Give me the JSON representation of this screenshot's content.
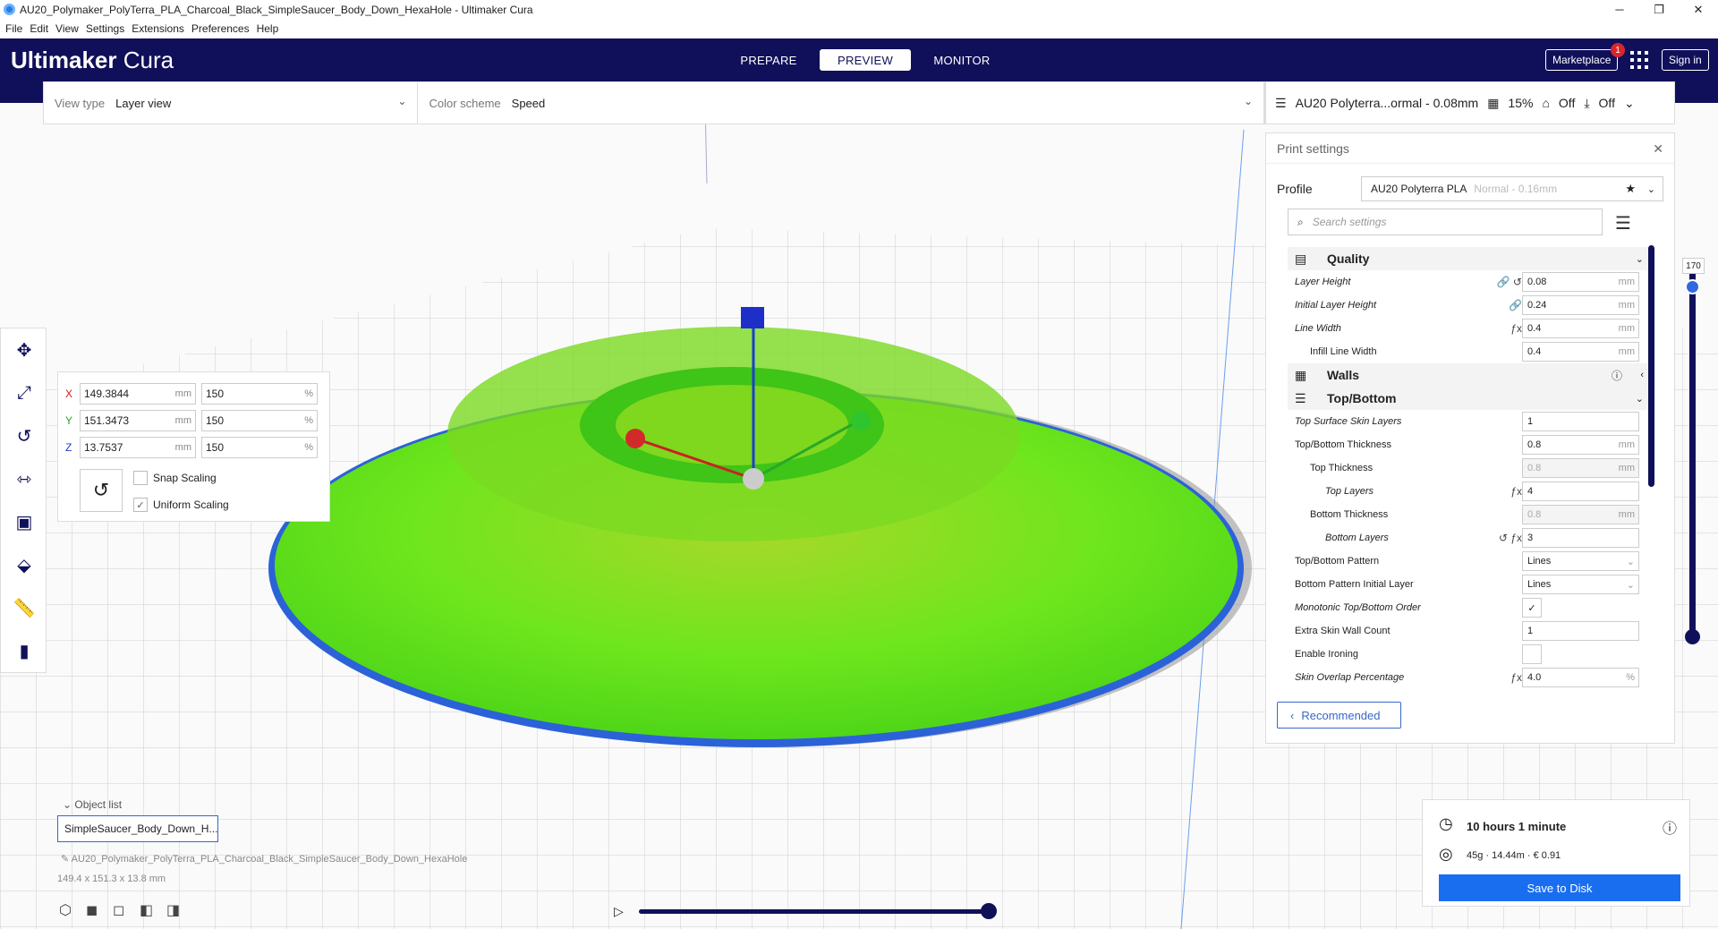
{
  "window": {
    "title": "AU20_Polymaker_PolyTerra_PLA_Charcoal_Black_SimpleSaucer_Body_Down_HexaHole - Ultimaker Cura"
  },
  "menu": [
    "File",
    "Edit",
    "View",
    "Settings",
    "Extensions",
    "Preferences",
    "Help"
  ],
  "header": {
    "logo_bold": "Ultimaker",
    "logo_thin": "Cura",
    "stages": [
      "PREPARE",
      "PREVIEW",
      "MONITOR"
    ],
    "active_stage": "PREVIEW",
    "marketplace": "Marketplace",
    "marketplace_badge": "1",
    "signin": "Sign in"
  },
  "viewbar": {
    "view_type_label": "View type",
    "view_type_value": "Layer view",
    "color_scheme_label": "Color scheme",
    "color_scheme_value": "Speed"
  },
  "printbar": {
    "profile": "AU20 Polyterra...ormal - 0.08mm",
    "infill": "15%",
    "support": "Off",
    "adhesion": "Off"
  },
  "scale": {
    "x_mm": "149.3844",
    "y_mm": "151.3473",
    "z_mm": "13.7537",
    "x_pct": "150",
    "y_pct": "150",
    "z_pct": "150",
    "unit_mm": "mm",
    "unit_pct": "%",
    "snap": "Snap Scaling",
    "uniform": "Uniform Scaling"
  },
  "settings": {
    "title": "Print settings",
    "profile_label": "Profile",
    "profile_value": "AU20 Polyterra PLA",
    "profile_note": "Normal - 0.16mm",
    "search_placeholder": "Search settings",
    "recommended": "Recommended",
    "categories": {
      "quality": "Quality",
      "walls": "Walls",
      "topbottom": "Top/Bottom"
    },
    "rows": [
      {
        "label": "Layer Height",
        "value": "0.08",
        "unit": "mm"
      },
      {
        "label": "Initial Layer Height",
        "value": "0.24",
        "unit": "mm"
      },
      {
        "label": "Line Width",
        "value": "0.4",
        "unit": "mm"
      },
      {
        "label": "Infill Line Width",
        "value": "0.4",
        "unit": "mm"
      },
      {
        "label": "Top Surface Skin Layers",
        "value": "1",
        "unit": ""
      },
      {
        "label": "Top/Bottom Thickness",
        "value": "0.8",
        "unit": "mm"
      },
      {
        "label": "Top Thickness",
        "value": "0.8",
        "unit": "mm"
      },
      {
        "label": "Top Layers",
        "value": "4",
        "unit": ""
      },
      {
        "label": "Bottom Thickness",
        "value": "0.8",
        "unit": "mm"
      },
      {
        "label": "Bottom Layers",
        "value": "3",
        "unit": ""
      },
      {
        "label": "Top/Bottom Pattern",
        "value": "Lines",
        "unit": ""
      },
      {
        "label": "Bottom Pattern Initial Layer",
        "value": "Lines",
        "unit": ""
      },
      {
        "label": "Monotonic Top/Bottom Order",
        "value": "",
        "unit": ""
      },
      {
        "label": "Extra Skin Wall Count",
        "value": "1",
        "unit": ""
      },
      {
        "label": "Enable Ironing",
        "value": "",
        "unit": ""
      },
      {
        "label": "Skin Overlap Percentage",
        "value": "4.0",
        "unit": "%"
      }
    ]
  },
  "layer": {
    "current": "170"
  },
  "objects": {
    "label": "Object list",
    "selected": "SimpleSaucer_Body_Down_H...",
    "full_name": "AU20_Polymaker_PolyTerra_PLA_Charcoal_Black_SimpleSaucer_Body_Down_HexaHole",
    "dimensions": "149.4 x 151.3 x 13.8 mm"
  },
  "estimate": {
    "time": "10 hours 1 minute",
    "material": "45g · 14.44m · € 0.91",
    "save": "Save to Disk"
  },
  "colors": {
    "header": "#10105a",
    "accent": "#196ef0",
    "model": "#5fe81a"
  }
}
